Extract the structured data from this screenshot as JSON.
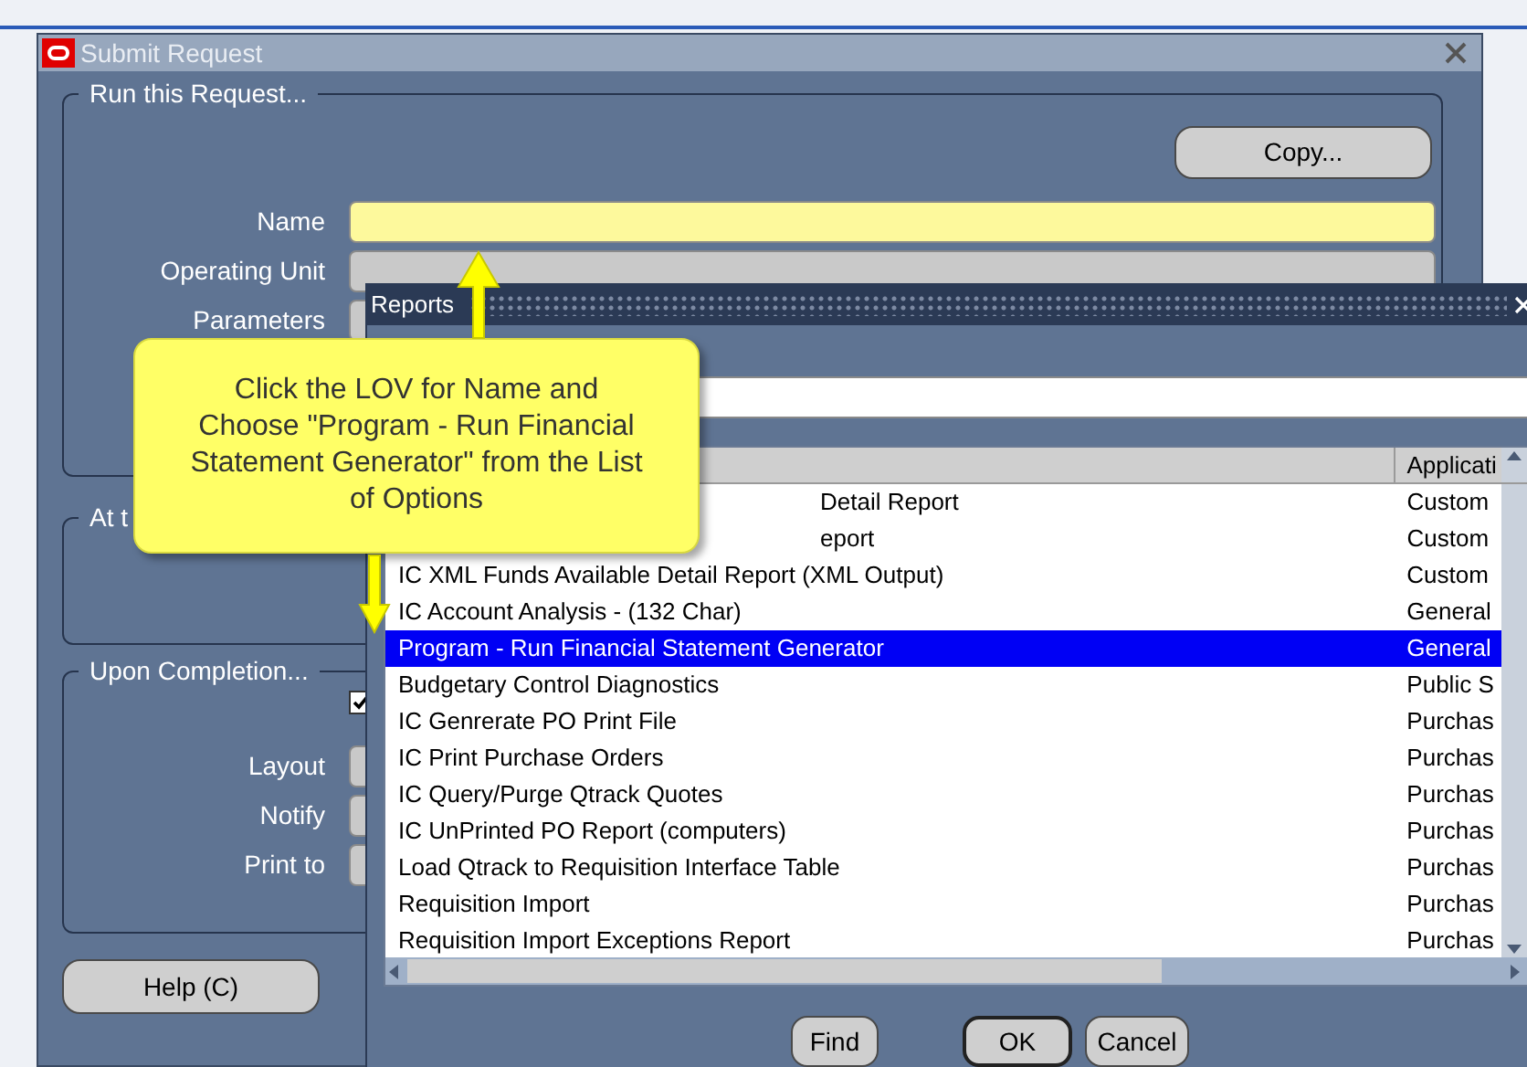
{
  "submit_window": {
    "title": "Submit Request",
    "copy_button": "Copy...",
    "groups": [
      {
        "kind": "request",
        "legend": "Run this Request...",
        "fields": [
          {
            "label": "Name",
            "kind": "active"
          },
          {
            "label": "Operating Unit",
            "kind": "plain"
          },
          {
            "label": "Parameters",
            "kind": "plain"
          }
        ]
      },
      {
        "kind": "schedule",
        "legend": "At t"
      },
      {
        "kind": "completion",
        "legend": "Upon Completion...",
        "checkbox": {
          "checked": true
        },
        "fields": [
          {
            "label": "Layout",
            "kind": "plain"
          },
          {
            "label": "Notify",
            "kind": "plain"
          },
          {
            "label": "Print to",
            "kind": "plain"
          }
        ]
      }
    ],
    "help_button": "Help (C)"
  },
  "reports_window": {
    "title": "Reports",
    "table": {
      "columns": [
        "Applicati"
      ],
      "rows": [
        {
          "name": "Detail Report",
          "application": "Custom",
          "selected": false,
          "kind": "covered"
        },
        {
          "name": "eport",
          "application": "Custom",
          "selected": false,
          "kind": "covered"
        },
        {
          "name": "IC XML Funds Available Detail Report (XML Output)",
          "application": "Custom",
          "selected": false
        },
        {
          "name": "IC Account Analysis - (132 Char)",
          "application": "General",
          "selected": false
        },
        {
          "name": "Program - Run Financial Statement Generator",
          "application": "General",
          "selected": true
        },
        {
          "name": "Budgetary Control Diagnostics",
          "application": "Public S",
          "selected": false
        },
        {
          "name": "IC Genrerate PO Print File",
          "application": "Purchas",
          "selected": false
        },
        {
          "name": "IC Print Purchase Orders",
          "application": "Purchas",
          "selected": false
        },
        {
          "name": "IC Query/Purge Qtrack Quotes",
          "application": "Purchas",
          "selected": false
        },
        {
          "name": "IC UnPrinted PO Report (computers)",
          "application": "Purchas",
          "selected": false
        },
        {
          "name": "Load Qtrack to Requisition Interface Table",
          "application": "Purchas",
          "selected": false
        },
        {
          "name": "Requisition Import",
          "application": "Purchas",
          "selected": false
        },
        {
          "name": "Requisition Import Exceptions Report",
          "application": "Purchas",
          "selected": false
        }
      ]
    },
    "buttons": [
      "Find",
      "OK",
      "Cancel"
    ]
  },
  "callout": {
    "text": "Click the LOV for Name and Choose \"Program - Run Financial Statement Generator\" from the List of Options"
  }
}
